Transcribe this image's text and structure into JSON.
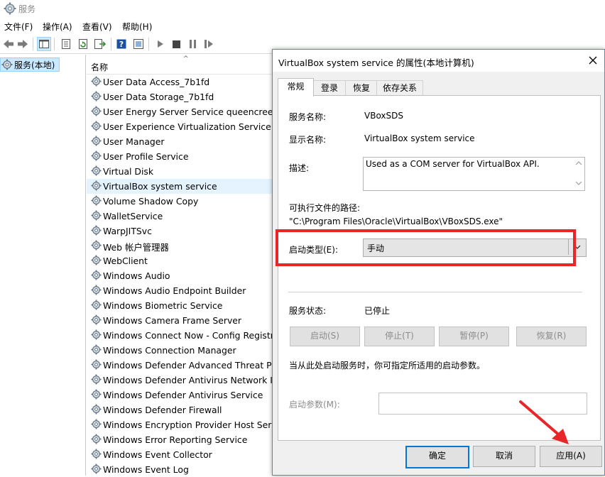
{
  "window": {
    "title": "服务"
  },
  "menu": [
    "文件(F)",
    "操作(A)",
    "查看(V)",
    "帮助(H)"
  ],
  "toolbar": {
    "icons": [
      "back-icon",
      "forward-icon",
      "show-tree-icon",
      "properties-icon",
      "refresh-icon",
      "export-icon",
      "help-icon",
      "panel-icon",
      "play-icon",
      "stop-icon",
      "pause-icon",
      "restart-icon"
    ]
  },
  "tree": {
    "selected_label": "服务(本地)"
  },
  "list": {
    "column_header": "名称",
    "selected_index": 7,
    "items": [
      "User Data Access_7b1fd",
      "User Data Storage_7b1fd",
      "User Energy Server Service queencreek",
      "User Experience Virtualization Service",
      "User Manager",
      "User Profile Service",
      "Virtual Disk",
      "VirtualBox system service",
      "Volume Shadow Copy",
      "WalletService",
      "WarpJITSvc",
      "Web 帐户管理器",
      "WebClient",
      "Windows Audio",
      "Windows Audio Endpoint Builder",
      "Windows Biometric Service",
      "Windows Camera Frame Server",
      "Windows Connect Now - Config Registrar",
      "Windows Connection Manager",
      "Windows Defender Advanced Threat Protection",
      "Windows Defender Antivirus Network Inspection",
      "Windows Defender Antivirus Service",
      "Windows Defender Firewall",
      "Windows Encryption Provider Host Service",
      "Windows Error Reporting Service",
      "Windows Event Collector",
      "Windows Event Log"
    ]
  },
  "dialog": {
    "title": "VirtualBox system service 的属性(本地计算机)",
    "tabs": [
      "常规",
      "登录",
      "恢复",
      "依存关系"
    ],
    "active_tab": 0,
    "service_name_label": "服务名称:",
    "service_name": "VBoxSDS",
    "display_name_label": "显示名称:",
    "display_name": "VirtualBox system service",
    "description_label": "描述:",
    "description": "Used as a COM server for VirtualBox API.",
    "path_label": "可执行文件的路径:",
    "path": "\"C:\\Program Files\\Oracle\\VirtualBox\\VBoxSDS.exe\"",
    "startup_type_label": "启动类型(E):",
    "startup_type": "手动",
    "status_label": "服务状态:",
    "status": "已停止",
    "buttons": {
      "start": "启动(S)",
      "stop": "停止(T)",
      "pause": "暂停(P)",
      "resume": "恢复(R)"
    },
    "hint": "当从此处启动服务时，你可指定所适用的启动参数。",
    "params_label": "启动参数(M):",
    "params_value": "",
    "footer": {
      "ok": "确定",
      "cancel": "取消",
      "apply": "应用(A)"
    }
  },
  "highlight_color": "#e8262a"
}
